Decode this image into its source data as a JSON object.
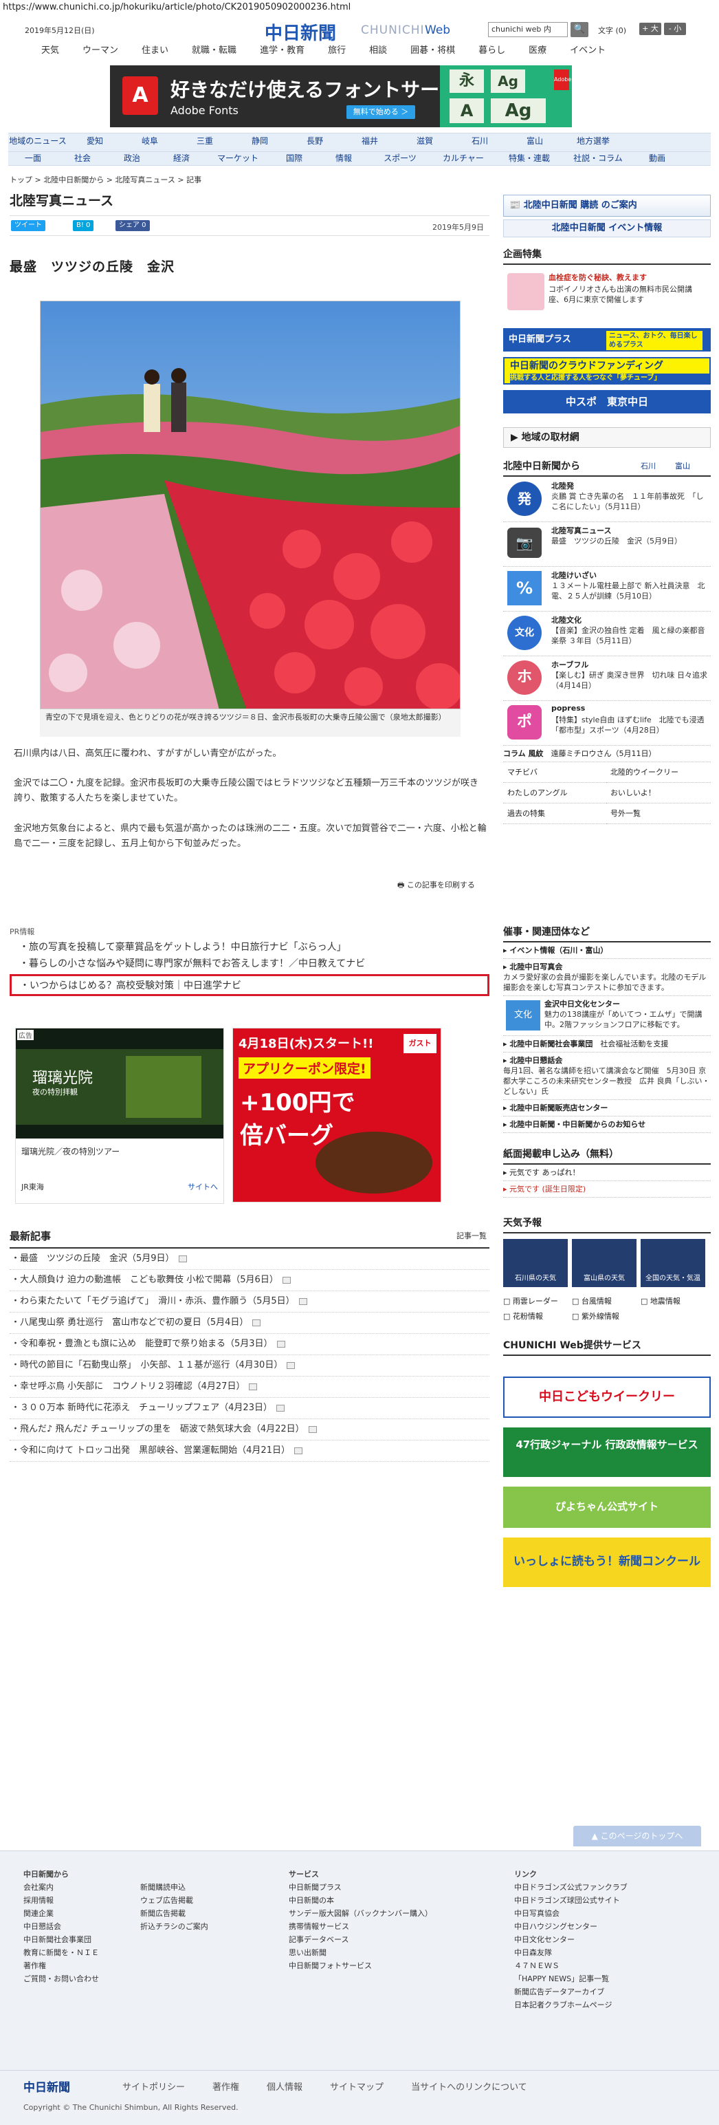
{
  "url": "https://www.chunichi.co.jp/hokuriku/article/photo/CK2019050902000236.html",
  "header": {
    "date": "2019年5月12日(日)",
    "logo": "中日新聞",
    "logo_sub": "CHUNICHI",
    "logo_web": "Web",
    "search_placeholder": "chunichi web 内",
    "font_label": "文字",
    "font_reset": "(0)",
    "font_bigger": "+ 大",
    "font_smaller": "- 小"
  },
  "global_nav": [
    "天気",
    "ウーマン",
    "住まい",
    "就職・転職",
    "進学・教育",
    "旅行",
    "相談",
    "囲碁・将棋",
    "暮らし",
    "医療",
    "イベント"
  ],
  "banner": {
    "line1": "好きなだけ使えるフォントサービス",
    "line2": "Adobe Fonts",
    "cta": "無料で始める ＞",
    "logo_letter": "A",
    "tiles": [
      "永",
      "Ag",
      "A",
      "Ag"
    ]
  },
  "category_nav": {
    "row1": [
      "地域のニュース",
      "愛知",
      "岐阜",
      "三重",
      "静岡",
      "長野",
      "福井",
      "滋賀",
      "石川",
      "富山",
      "地方選挙"
    ],
    "row2": [
      "一面",
      "社会",
      "政治",
      "経済",
      "マーケット",
      "国際",
      "情報",
      "スポーツ",
      "カルチャー",
      "特集・連載",
      "社説・コラム",
      "動画"
    ]
  },
  "breadcrumb": "トップ > 北陸中日新聞から > 北陸写真ニュース > 記事",
  "section_title": "北陸写真ニュース",
  "share": {
    "tweet": "ツイート",
    "hatena": "B! 0",
    "facebook": "シェア 0"
  },
  "article": {
    "date": "2019年5月9日",
    "headline": "最盛　ツツジの丘陵　金沢",
    "caption": "青空の下で見頃を迎え、色とりどりの花が咲き誇るツツジ＝８日、金沢市長坂町の大乗寺丘陵公園で（泉地太郎撮影）",
    "paragraphs": [
      "石川県内は八日、高気圧に覆われ、すがすがしい青空が広がった。",
      "金沢では二〇・九度を記録。金沢市長坂町の大乗寺丘陵公園ではヒラドツツジなど五種類一万三千本のツツジが咲き誇り、散策する人たちを楽しませていた。",
      "金沢地方気象台によると、県内で最も気温が高かったのは珠洲の二二・五度。次いで加賀菅谷で二一・六度、小松と輪島で二一・三度を記録し、五月上旬から下旬並みだった。"
    ],
    "print": "この記事を印刷する"
  },
  "pr": {
    "label": "PR情報",
    "items": [
      "旅の写真を投稿して豪華賞品をゲットしよう！中日旅行ナビ「ぶらっ人」",
      "暮らしの小さな悩みや疑問に専門家が無料でお答えします！／中日教えてナビ"
    ],
    "highlight": "いつからはじめる？高校受験対策｜中日進学ナビ"
  },
  "ads": {
    "left_badge": "広告",
    "left_title": "瑠璃光院",
    "left_sub": "夜の特別拝観",
    "left_caption": "瑠璃光院／夜の特別ツアー",
    "left_sponsor": "JR東海",
    "left_link": "サイトへ",
    "right_top": "4月18日(木)スタート!!",
    "right_mid": "アプリクーポン限定!",
    "right_big": "+100円で",
    "right_big2": "倍バーグ",
    "right_brand": "ガスト"
  },
  "latest": {
    "title": "最新記事",
    "more": "記事一覧",
    "items": [
      "最盛　ツツジの丘陵　金沢（5月9日）",
      "大人顔負け 迫力の動進帳　こども歌舞伎 小松で開幕（5月6日）",
      "わら束たたいて「モグラ追げて」　滑川・赤浜、豊作願う（5月5日）",
      "八尾曳山祭 勇壮巡行　富山市などで初の夏日（5月4日）",
      "令和奉祝・豊漁とも旗に込め　能登町で祭り始まる（5月3日）",
      "時代の節目に「石動曳山祭」　小矢部、１１基が巡行（4月30日）",
      "幸せ呼ぶ鳥 小矢部に　コウノトリ２羽確認（4月27日）",
      "３００万本 新時代に花添え　チューリップフェア（4月23日）",
      "飛んだ♪ 飛んだ♪ チューリップの里を　砺波で熱気球大会（4月22日）",
      "令和に向けて トロッコ出発　黒部峡谷、営業運転開始（4月21日）"
    ]
  },
  "sidebar": {
    "subscribe": "北陸中日新聞 購読 のご案内",
    "event_info": "北陸中日新聞 イベント情報",
    "feature_title": "企画特集",
    "feature_text": "血栓症を防ぐ秘訣、教えます",
    "feature_text2": "コボイノリオさんも出演の無料市民公開講座、6月に東京で開催します",
    "plus": "中日新聞プラス",
    "plus_sub": "ニュース、おトク、毎日楽しめるプラス",
    "crowd": "中日新聞のクラウドファンディング",
    "crowd_sub": "挑戦する人と応援する人をつなぐ「夢チューブ」",
    "sports": "中スポ　東京中日",
    "region_title": "地域の取材網",
    "hokuriku_title": "北陸中日新聞から",
    "hokuriku_links": [
      "石川",
      "富山"
    ],
    "news": [
      {
        "title": "北陸発",
        "text": "炎鵬 賞 亡き先輩の名　１１年前事故死　「しこ名にしたい」（5月11日）",
        "icon": "発"
      },
      {
        "title": "北陸写真ニュース",
        "text": "最盛　ツツジの丘陵　金沢（5月9日）",
        "icon": "cam"
      },
      {
        "title": "北陸けいざい",
        "text": "１３メートル電柱最上部で 新入社員決意　北電、２５人が訓練（5月10日）",
        "icon": "%"
      },
      {
        "title": "北陸文化",
        "text": "【音楽】金沢の独自性 定着　風と緑の楽都音楽祭 ３年目（5月11日）",
        "icon": "文化"
      },
      {
        "title": "ホーブフル",
        "text": "【楽しむ】研ぎ 奥深き世界　切れ味 日々追求（4月14日）",
        "icon": "ホ"
      },
      {
        "title": "popress",
        "text": "【特集】style自由 ほずむlife　北陸でも浸透「都市型」スポーツ（4月28日）",
        "icon": "ポ"
      }
    ],
    "column": {
      "label": "コラム 風紋",
      "text": "遠藤ミチロウさん（5月11日）"
    },
    "grid": [
      [
        "マチビバ",
        "北陸的ウイークリー"
      ],
      [
        "わたしのアングル",
        "おいしいよ！"
      ],
      [
        "過去の特集",
        "号外一覧"
      ]
    ],
    "org_title": "催事・関連団体など",
    "org_event": "イベント情報（石川・富山）",
    "orgs": [
      {
        "title": "北陸中日写真会",
        "text": "カメラ愛好家の会員が撮影を楽しんでいます。北陸のモデル撮影会を楽しむ写真コンテストに参加できます。"
      },
      {
        "title": "金沢中日文化センター",
        "text": "魅力の138講座が「めいてつ・エムザ」で開講中。2階ファッションフロアに移転です。",
        "icon": "文化"
      },
      {
        "title": "北陸中日新聞社会事業団",
        "text": "社会福祉活動を支援"
      },
      {
        "title": "北陸中日懇話会",
        "text": "毎月1回、著名な講師を招いて講演会など開催　5月30日 京都大学こころの未来研究センター教授　広井 良典「しぶい・どしない」氏"
      },
      {
        "title": "北陸中日新聞販売店センター",
        "text": ""
      },
      {
        "title": "北陸中日新聞・中日新聞からのお知らせ",
        "text": ""
      }
    ],
    "notice_title": "紙面掲載申し込み（無料）",
    "notices": [
      "元気です あっぱれ！",
      "元気です (誕生日限定)"
    ],
    "weather_title": "天気予報",
    "weather_tiles": [
      "石川県の天気",
      "富山県の天気",
      "全国の天気・気温"
    ],
    "weather_links": [
      "雨雲レーダー",
      "台風情報",
      "地震情報",
      "花粉情報",
      "紫外線情報"
    ],
    "service_title": "CHUNICHI Web提供サービス",
    "service_banners": [
      "中日こどもウイークリー",
      "47行政ジャーナル 行政政情報サービス",
      "ぴよちゃん公式サイト",
      "いっしょに読もう！新聞コンクール"
    ]
  },
  "footer": {
    "to_top": "このページのトップへ",
    "col1_title": "中日新聞から",
    "col1": [
      "会社案内",
      "採用情報",
      "関連企業",
      "中日懇話会",
      "中日新聞社会事業団",
      "教育に新聞を・ＮＩＥ",
      "著作権",
      "ご質問・お問い合わせ"
    ],
    "col2": [
      "新聞購読申込",
      "ウェブ広告掲載",
      "新聞広告掲載",
      "折込チラシのご案内"
    ],
    "col3_title": "サービス",
    "col3": [
      "中日新聞プラス",
      "中日新聞の本",
      "サンデー版大図解（バックナンバー購入）",
      "携帯情報サービス",
      "記事データベース",
      "思い出新聞",
      "中日新聞フォトサービス"
    ],
    "col4_title": "リンク",
    "col4": [
      "中日ドラゴンズ公式ファンクラブ",
      "中日ドラゴンズ球団公式サイト",
      "中日写真協会",
      "中日ハウジングセンター",
      "中日文化センター",
      "中日森友隊",
      "４７ＮＥＷＳ",
      "「HAPPY NEWS」記事一覧",
      "新聞広告データアーカイブ",
      "日本記者クラブホームページ"
    ],
    "bottom": [
      "中日新聞",
      "サイトポリシー",
      "著作権",
      "個人情報",
      "サイトマップ",
      "当サイトへのリンクについて"
    ],
    "copyright": "Copyright © The Chunichi Shimbun, All Rights Reserved."
  }
}
